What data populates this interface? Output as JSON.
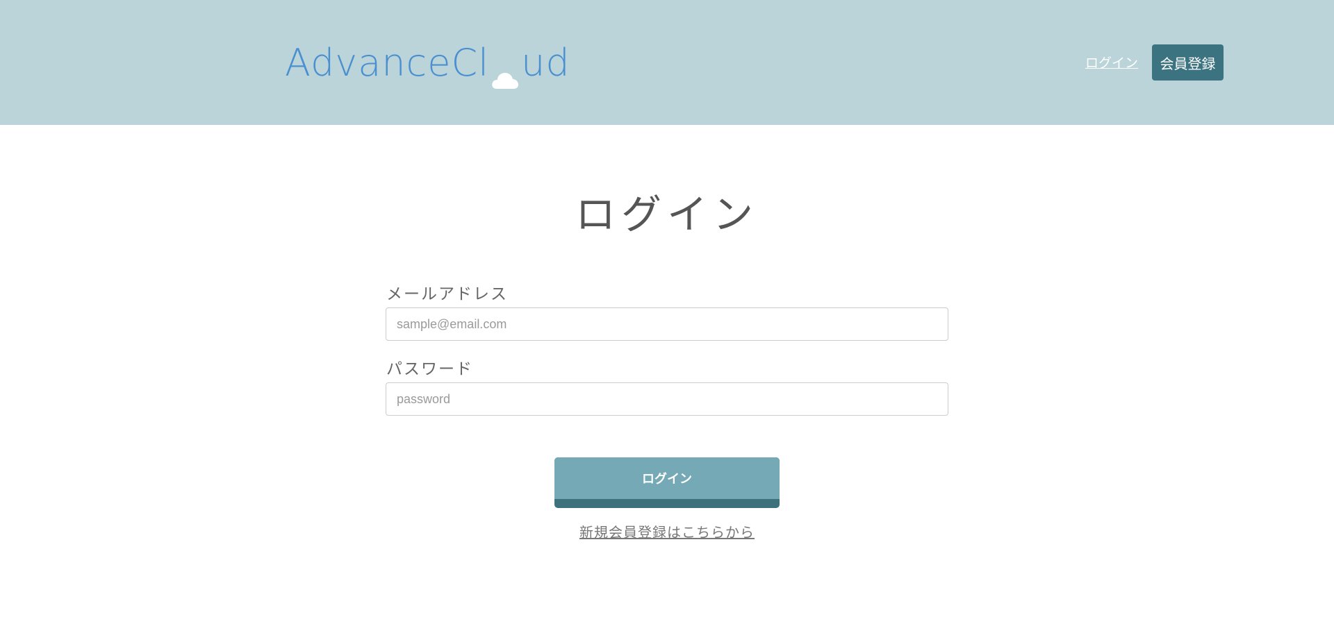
{
  "header": {
    "logo_text_left": "AdvanceCl",
    "logo_text_right": "ud",
    "logo_icon": "cloud-icon",
    "nav_login": "ログイン",
    "nav_register": "会員登録"
  },
  "main": {
    "title": "ログイン",
    "email": {
      "label": "メールアドレス",
      "placeholder": "sample@email.com",
      "value": ""
    },
    "password": {
      "label": "パスワード",
      "placeholder": "password",
      "value": ""
    },
    "submit_label": "ログイン",
    "register_link": "新規会員登録はこちらから"
  },
  "colors": {
    "header_bg": "#bad4d9",
    "logo": "#4a8fcf",
    "register_button": "#3b7380",
    "submit_button": "#74a9b5",
    "submit_shadow": "#3d727d"
  }
}
